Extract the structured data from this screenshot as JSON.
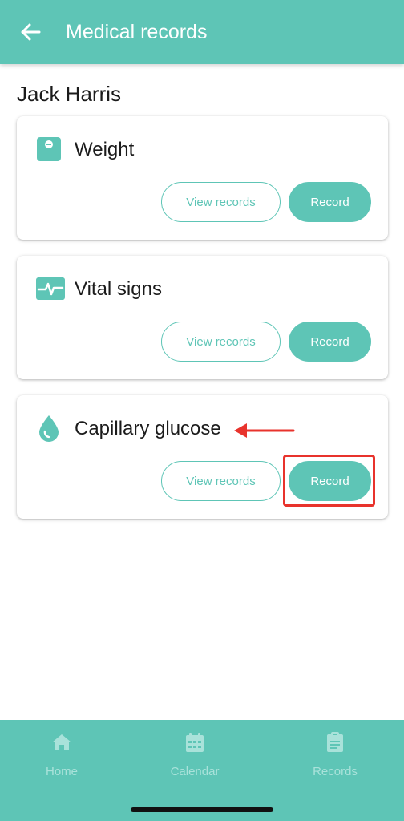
{
  "header": {
    "title": "Medical records",
    "back_icon": "arrow-left-icon"
  },
  "patient": {
    "name": "Jack Harris"
  },
  "cards": [
    {
      "title": "Weight",
      "icon": "scale-icon",
      "view_label": "View records",
      "record_label": "Record"
    },
    {
      "title": "Vital signs",
      "icon": "heartbeat-icon",
      "view_label": "View records",
      "record_label": "Record"
    },
    {
      "title": "Capillary glucose",
      "icon": "drop-icon",
      "view_label": "View records",
      "record_label": "Record"
    }
  ],
  "bottom_nav": [
    {
      "label": "Home",
      "icon": "home-icon"
    },
    {
      "label": "Calendar",
      "icon": "calendar-icon"
    },
    {
      "label": "Records",
      "icon": "clipboard-icon"
    }
  ],
  "colors": {
    "accent": "#5ec5b6",
    "annotation": "#e8332c",
    "nav_inactive": "#a9e2da"
  }
}
